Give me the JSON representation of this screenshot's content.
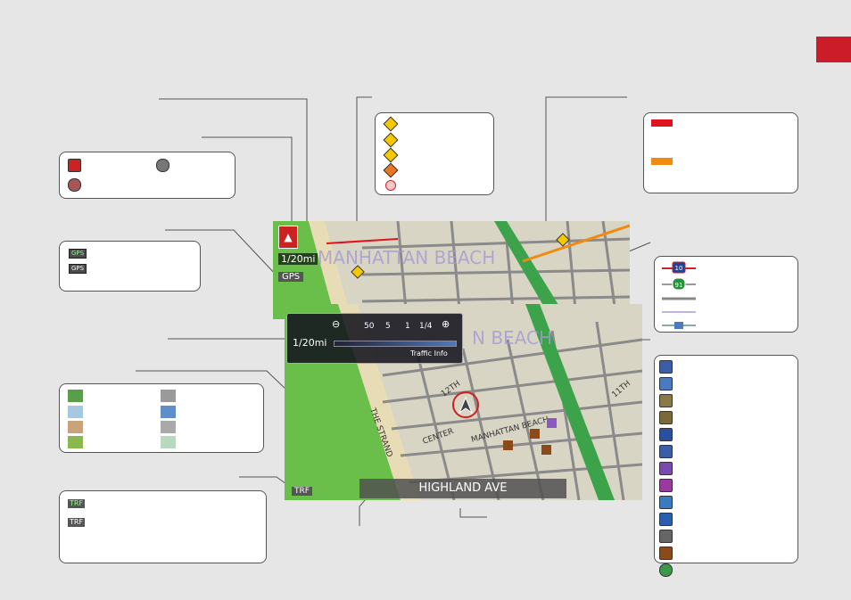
{
  "map_main": {
    "scale": "1/20mi",
    "gps": "GPS",
    "city": "MANHATTAN BEACH"
  },
  "map_inset": {
    "city": "N BEACH",
    "scale": "1/20mi",
    "zoom_levels": [
      "50",
      "5",
      "1",
      "1/4"
    ],
    "traffic_info": "Traffic Info",
    "trf": "TRF",
    "street_current": "HIGHLAND AVE",
    "streets": [
      "THE STRAND",
      "CENTER",
      "MANHATTAN BEACH",
      "11TH",
      "12TH"
    ]
  },
  "gps_box": {
    "icon1": "GPS",
    "icon2": "GPS"
  },
  "trf_box": {
    "icon1": "TRF",
    "icon2": "TRF"
  },
  "highway_box": {
    "interstate": "10",
    "state_route": "91"
  },
  "colors": {
    "tab": "#cc1c2a",
    "congestion_heavy": "#e0141e",
    "congestion_moderate": "#f08a12",
    "land_swatches": [
      "#5b9e4a",
      "#9a9a9a",
      "#a8c8e2",
      "#5e8fc8",
      "#c9a47a",
      "#a9a9a9",
      "#8bb84e",
      "#b9d9bf"
    ]
  },
  "icons": {
    "orientation": [
      "north-up-icon",
      "heading-up-icon",
      "3d-view-icon"
    ],
    "incidents": [
      "accident-icon",
      "caution-icon",
      "construction-icon",
      "weather-icon",
      "road-closed-icon"
    ],
    "poi": [
      "auto-dealer-icon",
      "atm-icon",
      "bank-icon",
      "hotel-icon",
      "parking-lot-icon",
      "parking-garage-icon",
      "shopping-icon",
      "lodging-icon",
      "gas-station-icon",
      "hospital-icon",
      "post-office-icon",
      "restaurant-icon",
      "info-icon"
    ]
  }
}
